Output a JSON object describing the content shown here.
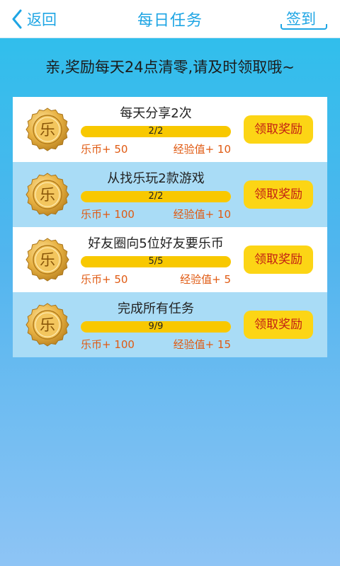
{
  "header": {
    "back_label": "返回",
    "title": "每日任务",
    "signin_label": "签到"
  },
  "notice": "亲,奖励每天24点清零,请及时领取哦~",
  "coin_glyph": "乐",
  "colors": {
    "accent": "#1ea5e4",
    "claim_bg": "#fcd515",
    "claim_text": "#c21d14",
    "reward_text": "#e05a12",
    "progress_fill": "#f8c800"
  },
  "tasks": [
    {
      "name": "每天分享2次",
      "progress_text": "2/2",
      "progress_fraction": 1,
      "reward_coin": "乐币+ 50",
      "reward_exp": "经验值+ 10",
      "claim_label": "领取奖励"
    },
    {
      "name": "从找乐玩2款游戏",
      "progress_text": "2/2",
      "progress_fraction": 1,
      "reward_coin": "乐币+ 100",
      "reward_exp": "经验值+ 10",
      "claim_label": "领取奖励"
    },
    {
      "name": "好友圈向5位好友要乐币",
      "progress_text": "5/5",
      "progress_fraction": 1,
      "reward_coin": "乐币+ 50",
      "reward_exp": "经验值+ 5",
      "claim_label": "领取奖励"
    },
    {
      "name": "完成所有任务",
      "progress_text": "9/9",
      "progress_fraction": 1,
      "reward_coin": "乐币+ 100",
      "reward_exp": "经验值+ 15",
      "claim_label": "领取奖励"
    }
  ]
}
